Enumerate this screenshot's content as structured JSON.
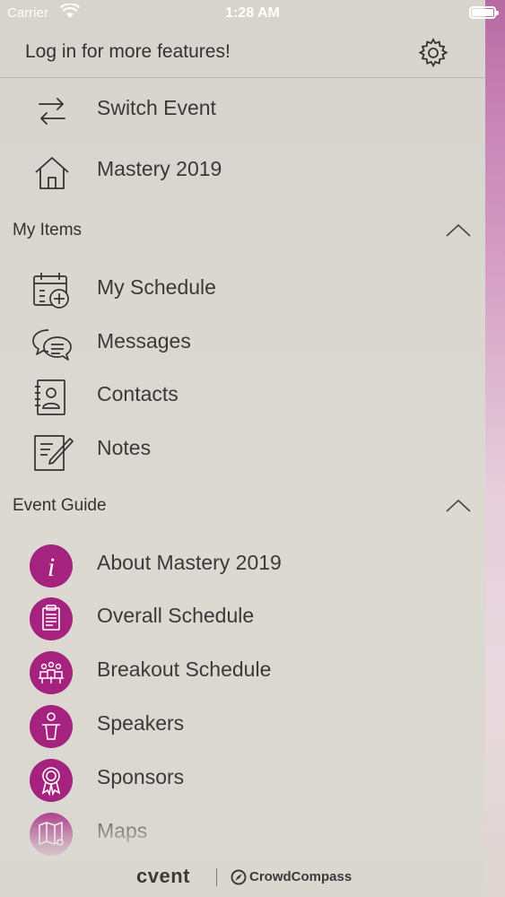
{
  "status_bar": {
    "carrier": "Carrier",
    "time": "1:28 AM"
  },
  "header": {
    "title": "Log in for more features!"
  },
  "top_items": [
    {
      "label": "Switch Event",
      "icon": "switch-arrows-icon"
    },
    {
      "label": "Mastery 2019",
      "icon": "home-icon"
    }
  ],
  "sections": {
    "my_items": {
      "title": "My Items",
      "items": [
        {
          "label": "My Schedule",
          "icon": "calendar-add-icon"
        },
        {
          "label": "Messages",
          "icon": "chat-bubbles-icon"
        },
        {
          "label": "Contacts",
          "icon": "address-book-icon"
        },
        {
          "label": "Notes",
          "icon": "notes-icon"
        }
      ]
    },
    "event_guide": {
      "title": "Event Guide",
      "items": [
        {
          "label": "About Mastery 2019",
          "icon": "info-icon"
        },
        {
          "label": "Overall Schedule",
          "icon": "clipboard-icon"
        },
        {
          "label": "Breakout Schedule",
          "icon": "group-icon"
        },
        {
          "label": "Speakers",
          "icon": "podium-icon"
        },
        {
          "label": "Sponsors",
          "icon": "award-ribbon-icon"
        },
        {
          "label": "Maps",
          "icon": "map-icon"
        }
      ]
    }
  },
  "footer": {
    "brand_left": "cvent",
    "brand_right": "CrowdCompass"
  },
  "colors": {
    "accent": "#a5237e",
    "text": "#3a3a3a",
    "background": "#dcd9d3"
  }
}
